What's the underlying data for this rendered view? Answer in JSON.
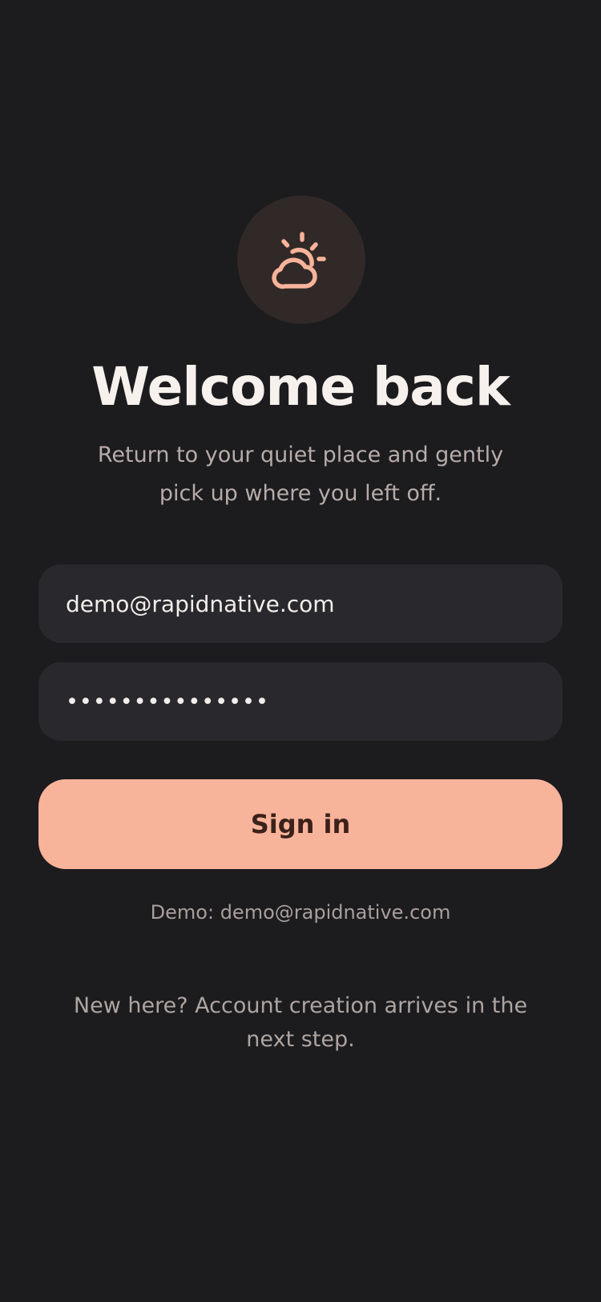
{
  "brand": {
    "icon": "sun-behind-cloud-icon",
    "icon_color": "#f8b39b"
  },
  "header": {
    "title": "Welcome back",
    "subtitle": "Return to your quiet place and gently pick up where you left off."
  },
  "form": {
    "email_value": "demo@rapidnative.com",
    "password_value": "•••••••••••••••",
    "submit_label": "Sign in"
  },
  "demo_hint": "Demo: demo@rapidnative.com",
  "footer_note": "New here? Account creation arrives in the next step.",
  "colors": {
    "background": "#1c1b1e",
    "accent": "#f8b39b",
    "field_background": "#29282c"
  }
}
